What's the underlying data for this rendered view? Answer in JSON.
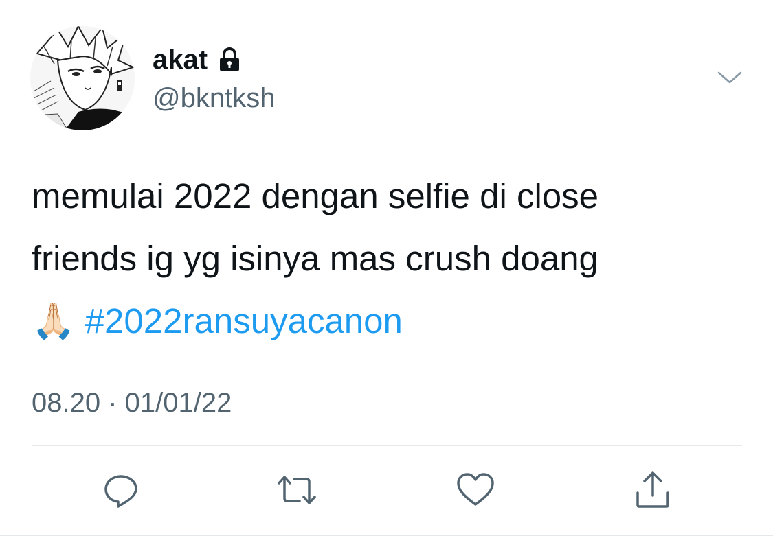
{
  "user": {
    "display_name": "akat",
    "handle": "@bkntksh",
    "locked": true
  },
  "tweet": {
    "line1": "memulai 2022 dengan selfie di close",
    "line2": "friends ig yg isinya mas crush doang",
    "emoji": "🙏🏻",
    "hashtag": "#2022ransuyacanon",
    "timestamp": "08.20 · 01/01/22"
  },
  "icons": {
    "lock": "lock-icon",
    "caret": "chevron-down-icon",
    "reply": "reply-icon",
    "retweet": "retweet-icon",
    "like": "heart-icon",
    "share": "share-icon"
  },
  "colors": {
    "text": "#0f1419",
    "secondary": "#536471",
    "link": "#1d9bf0",
    "divider": "#e6e9eb"
  }
}
